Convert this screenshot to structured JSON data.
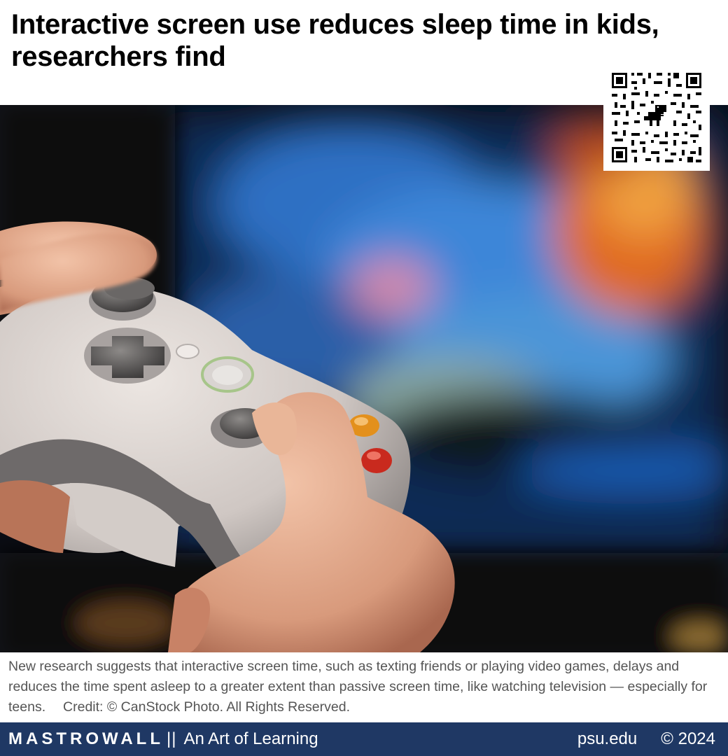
{
  "headline": "Interactive screen use reduces sleep time in kids, researchers find",
  "caption": "New research suggests that interactive screen time, such as texting friends or playing video games, delays and reduces the time spent asleep to a greater extent than passive screen time, like watching television — especially for teens.  Credit: © CanStock Photo. All Rights Reserved.",
  "footer": {
    "brand": "MASTROWALL",
    "separator": "||",
    "tagline": "An Art of Learning",
    "site": "psu.edu",
    "copyright": "© 2024"
  },
  "qr_icon": "dinosaur-icon",
  "colors": {
    "footer_bg": "#1f3864",
    "caption_text": "#555555"
  }
}
